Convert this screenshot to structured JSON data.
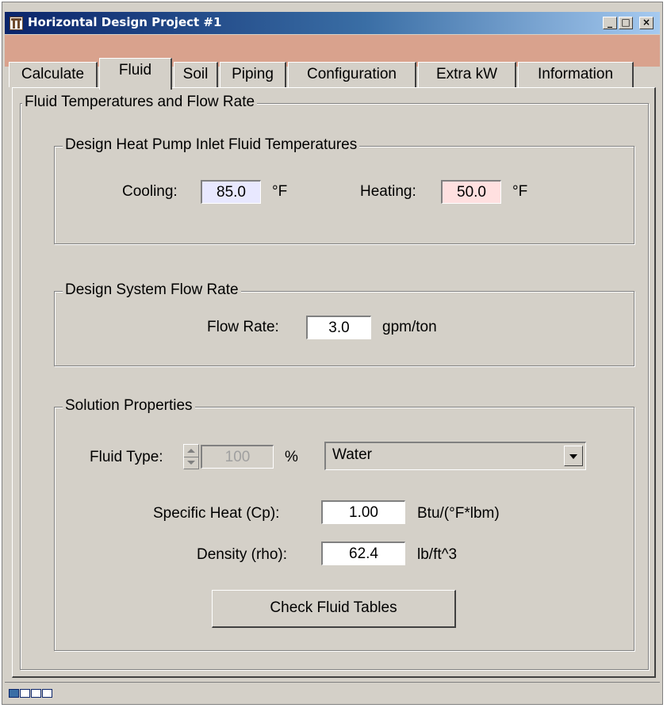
{
  "window": {
    "title": "Horizontal Design Project #1",
    "controls": {
      "minimize": "_",
      "maximize": "□",
      "close": "×"
    }
  },
  "tabs": [
    {
      "label": "Calculate"
    },
    {
      "label": "Fluid",
      "active": true
    },
    {
      "label": "Soil"
    },
    {
      "label": "Piping"
    },
    {
      "label": "Configuration"
    },
    {
      "label": "Extra kW"
    },
    {
      "label": "Information"
    }
  ],
  "panel": {
    "title": "Fluid Temperatures and Flow Rate",
    "temps": {
      "title": "Design Heat Pump Inlet Fluid Temperatures",
      "cooling_label": "Cooling:",
      "cooling_value": "85.0",
      "cooling_unit": "°F",
      "heating_label": "Heating:",
      "heating_value": "50.0",
      "heating_unit": "°F"
    },
    "flow": {
      "title": "Design System Flow Rate",
      "label": "Flow Rate:",
      "value": "3.0",
      "unit": "gpm/ton"
    },
    "solution": {
      "title": "Solution Properties",
      "fluid_type_label": "Fluid Type:",
      "concentration_value": "100",
      "concentration_unit": "%",
      "fluid_selected": "Water",
      "cp_label": "Specific Heat (Cp):",
      "cp_value": "1.00",
      "cp_unit": "Btu/(°F*lbm)",
      "density_label": "Density (rho):",
      "density_value": "62.4",
      "density_unit": "lb/ft^3",
      "check_button": "Check Fluid Tables"
    }
  },
  "colors": {
    "title_gradient_start": "#0a246a",
    "title_gradient_end": "#a6caf0",
    "window_bg": "#d4d0c8",
    "client_bg": "#d9a28d",
    "cooling_field": "#e8e8ff",
    "heating_field": "#ffe0e0"
  },
  "status": {
    "progress_segments": 4,
    "progress_filled": 1
  }
}
